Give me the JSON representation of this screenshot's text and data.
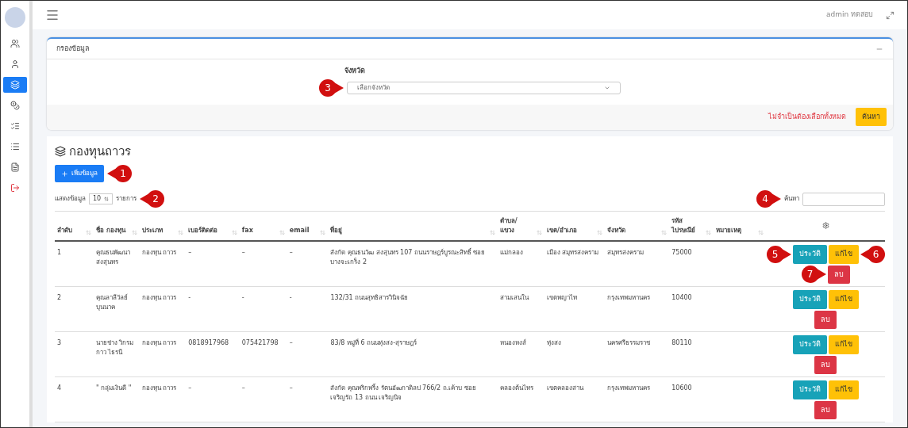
{
  "topbar": {
    "user": "admin ทดสอบ"
  },
  "sidebar": {
    "items": [
      {
        "selected": false
      },
      {
        "selected": false
      },
      {
        "selected": true
      },
      {
        "selected": false
      },
      {
        "selected": false
      },
      {
        "selected": false
      },
      {
        "selected": false
      },
      {
        "selected": false
      }
    ]
  },
  "filter": {
    "title": "กรองข้อมูล",
    "province_label": "จังหวัด",
    "province_placeholder": "เลือกจังหวัด",
    "province_callout": "3",
    "note": "ไม่จำเป็นต้องเลือกทั้งหมด",
    "submit": "ค้นหา"
  },
  "section": {
    "title": "กองทุนถาวร",
    "add_button": "เพิ่มข้อมูล",
    "add_callout": "1",
    "show_label": "แสดงข้อมูล",
    "page_size": "10",
    "show_suffix": "รายการ",
    "show_callout": "2",
    "search_label": "ค้นหา",
    "search_callout": "4"
  },
  "table": {
    "columns": [
      "ลำดับ",
      "ชื่อ กองทุน",
      "ประเภท",
      "เบอร์ติดต่อ",
      "fax",
      "email",
      "ที่อยู่",
      "ตำบล/ แขวง",
      "เขต/อำเภอ",
      "จังหวัด",
      "รหัส ไปรษณีย์",
      "หมายเหตุ"
    ],
    "rows": [
      {
        "cells": [
          "1",
          "คุณธนพัฒนา สงสุนทร",
          "กองทุน ถาวร",
          "–",
          "–",
          "–",
          "สังกัด คุณธนวัฒ สงสุนทร 107 ถนนราษฎร์บูรณะสิทธิ์ ซอยบางจะเกร็ง 2",
          "แม่กลอง",
          "เมือง สมุทรสงคราม",
          "สมุทรสงคราม",
          "75000",
          ""
        ],
        "actions": [
          {
            "kind": "history",
            "label": "ประวัติ",
            "callout": "5"
          },
          {
            "kind": "edit",
            "label": "แก้ไข",
            "callout": "6"
          },
          {
            "kind": "delete",
            "label": "ลบ",
            "callout": "7"
          }
        ]
      },
      {
        "cells": [
          "2",
          "คุณลาลีวัลย์ บุนนาค",
          "กองทุน ถาวร",
          "-",
          "-",
          "-",
          "132/31 ถนนสุทธิสารวินิจฉัย",
          "สามเสนใน",
          "เขตพญาไท",
          "กรุงเทพมหานคร",
          "10400",
          ""
        ],
        "actions": [
          {
            "kind": "history",
            "label": "ประวัติ"
          },
          {
            "kind": "edit",
            "label": "แก้ไข"
          },
          {
            "kind": "delete",
            "label": "ลบ"
          }
        ]
      },
      {
        "cells": [
          "3",
          "นายช่าง วิกรม กาว ไธรนี",
          "กองทุน ถาวร",
          "0818917968",
          "075421798",
          "–",
          "83/8 หมู่ที่ 6 ถนนทุ่งสง-สุราษฎร์",
          "หนองหงส์",
          "ทุ่งสง",
          "นครศรีธรรมราช",
          "80110",
          ""
        ],
        "actions": [
          {
            "kind": "history",
            "label": "ประวัติ"
          },
          {
            "kind": "edit",
            "label": "แก้ไข"
          },
          {
            "kind": "delete",
            "label": "ลบ"
          }
        ]
      },
      {
        "cells": [
          "4",
          "\" กลุ่มเงินดี \"",
          "กองทุน ถาวร",
          "–",
          "–",
          "–",
          "สังกัด คุณพริกพริ้ง รัตนอัฒกาดิลป 766/2 ถ.เค้าบ ซอยเจริญรัถ 13 ถนน เจริญนิจ",
          "คลองต้นไทร",
          "เขตคลองสาน",
          "กรุงเทพมหานคร",
          "10600",
          ""
        ],
        "actions": [
          {
            "kind": "history",
            "label": "ประวัติ"
          },
          {
            "kind": "edit",
            "label": "แก้ไข"
          },
          {
            "kind": "delete",
            "label": "ลบ"
          }
        ]
      }
    ]
  }
}
